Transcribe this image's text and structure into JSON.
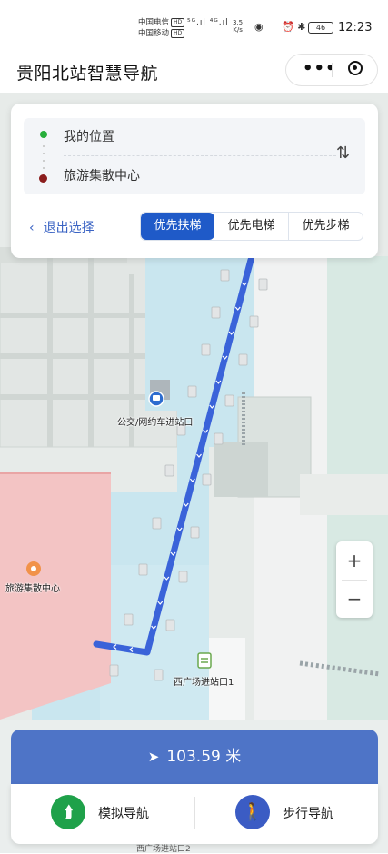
{
  "status_bar": {
    "carrier_1": "中国电信",
    "carrier_2": "中国移动",
    "hd_badge": "HD",
    "signal_text": "⁵ᴳ.ıl ⁴ᴳ.ıl",
    "speed_value": "3.5",
    "speed_unit": "K/s",
    "battery": "46",
    "time": "12:23"
  },
  "title_bar": {
    "title": "贵阳北站智慧导航",
    "more_icon": "more-dots-icon",
    "close_icon": "target-circle-icon"
  },
  "route": {
    "from": "我的位置",
    "to": "旅游集散中心",
    "swap_icon": "swap-arrows-icon"
  },
  "mode_bar": {
    "exit_label": "退出选择",
    "options": [
      "优先扶梯",
      "优先电梯",
      "优先步梯"
    ],
    "selected_index": 0
  },
  "map": {
    "labels": {
      "bus": "公交/网约车进站口",
      "tourism": "旅游集散中心",
      "west": "西广场进站口1",
      "bottom_partial": "西广场进站口2"
    },
    "zoom_in": "+",
    "zoom_out": "−"
  },
  "navigation": {
    "distance": "103.59 米",
    "simulate_label": "模拟导航",
    "walk_label": "步行导航"
  },
  "colors": {
    "accent": "#1f5ac8",
    "route_line": "#3a63d9",
    "distance_bar": "#4e74c7",
    "simulate_icon": "#1fa14a",
    "walk_icon": "#3b5cc4",
    "start_dot": "#27ae3b",
    "end_dot": "#8b1d1d"
  }
}
